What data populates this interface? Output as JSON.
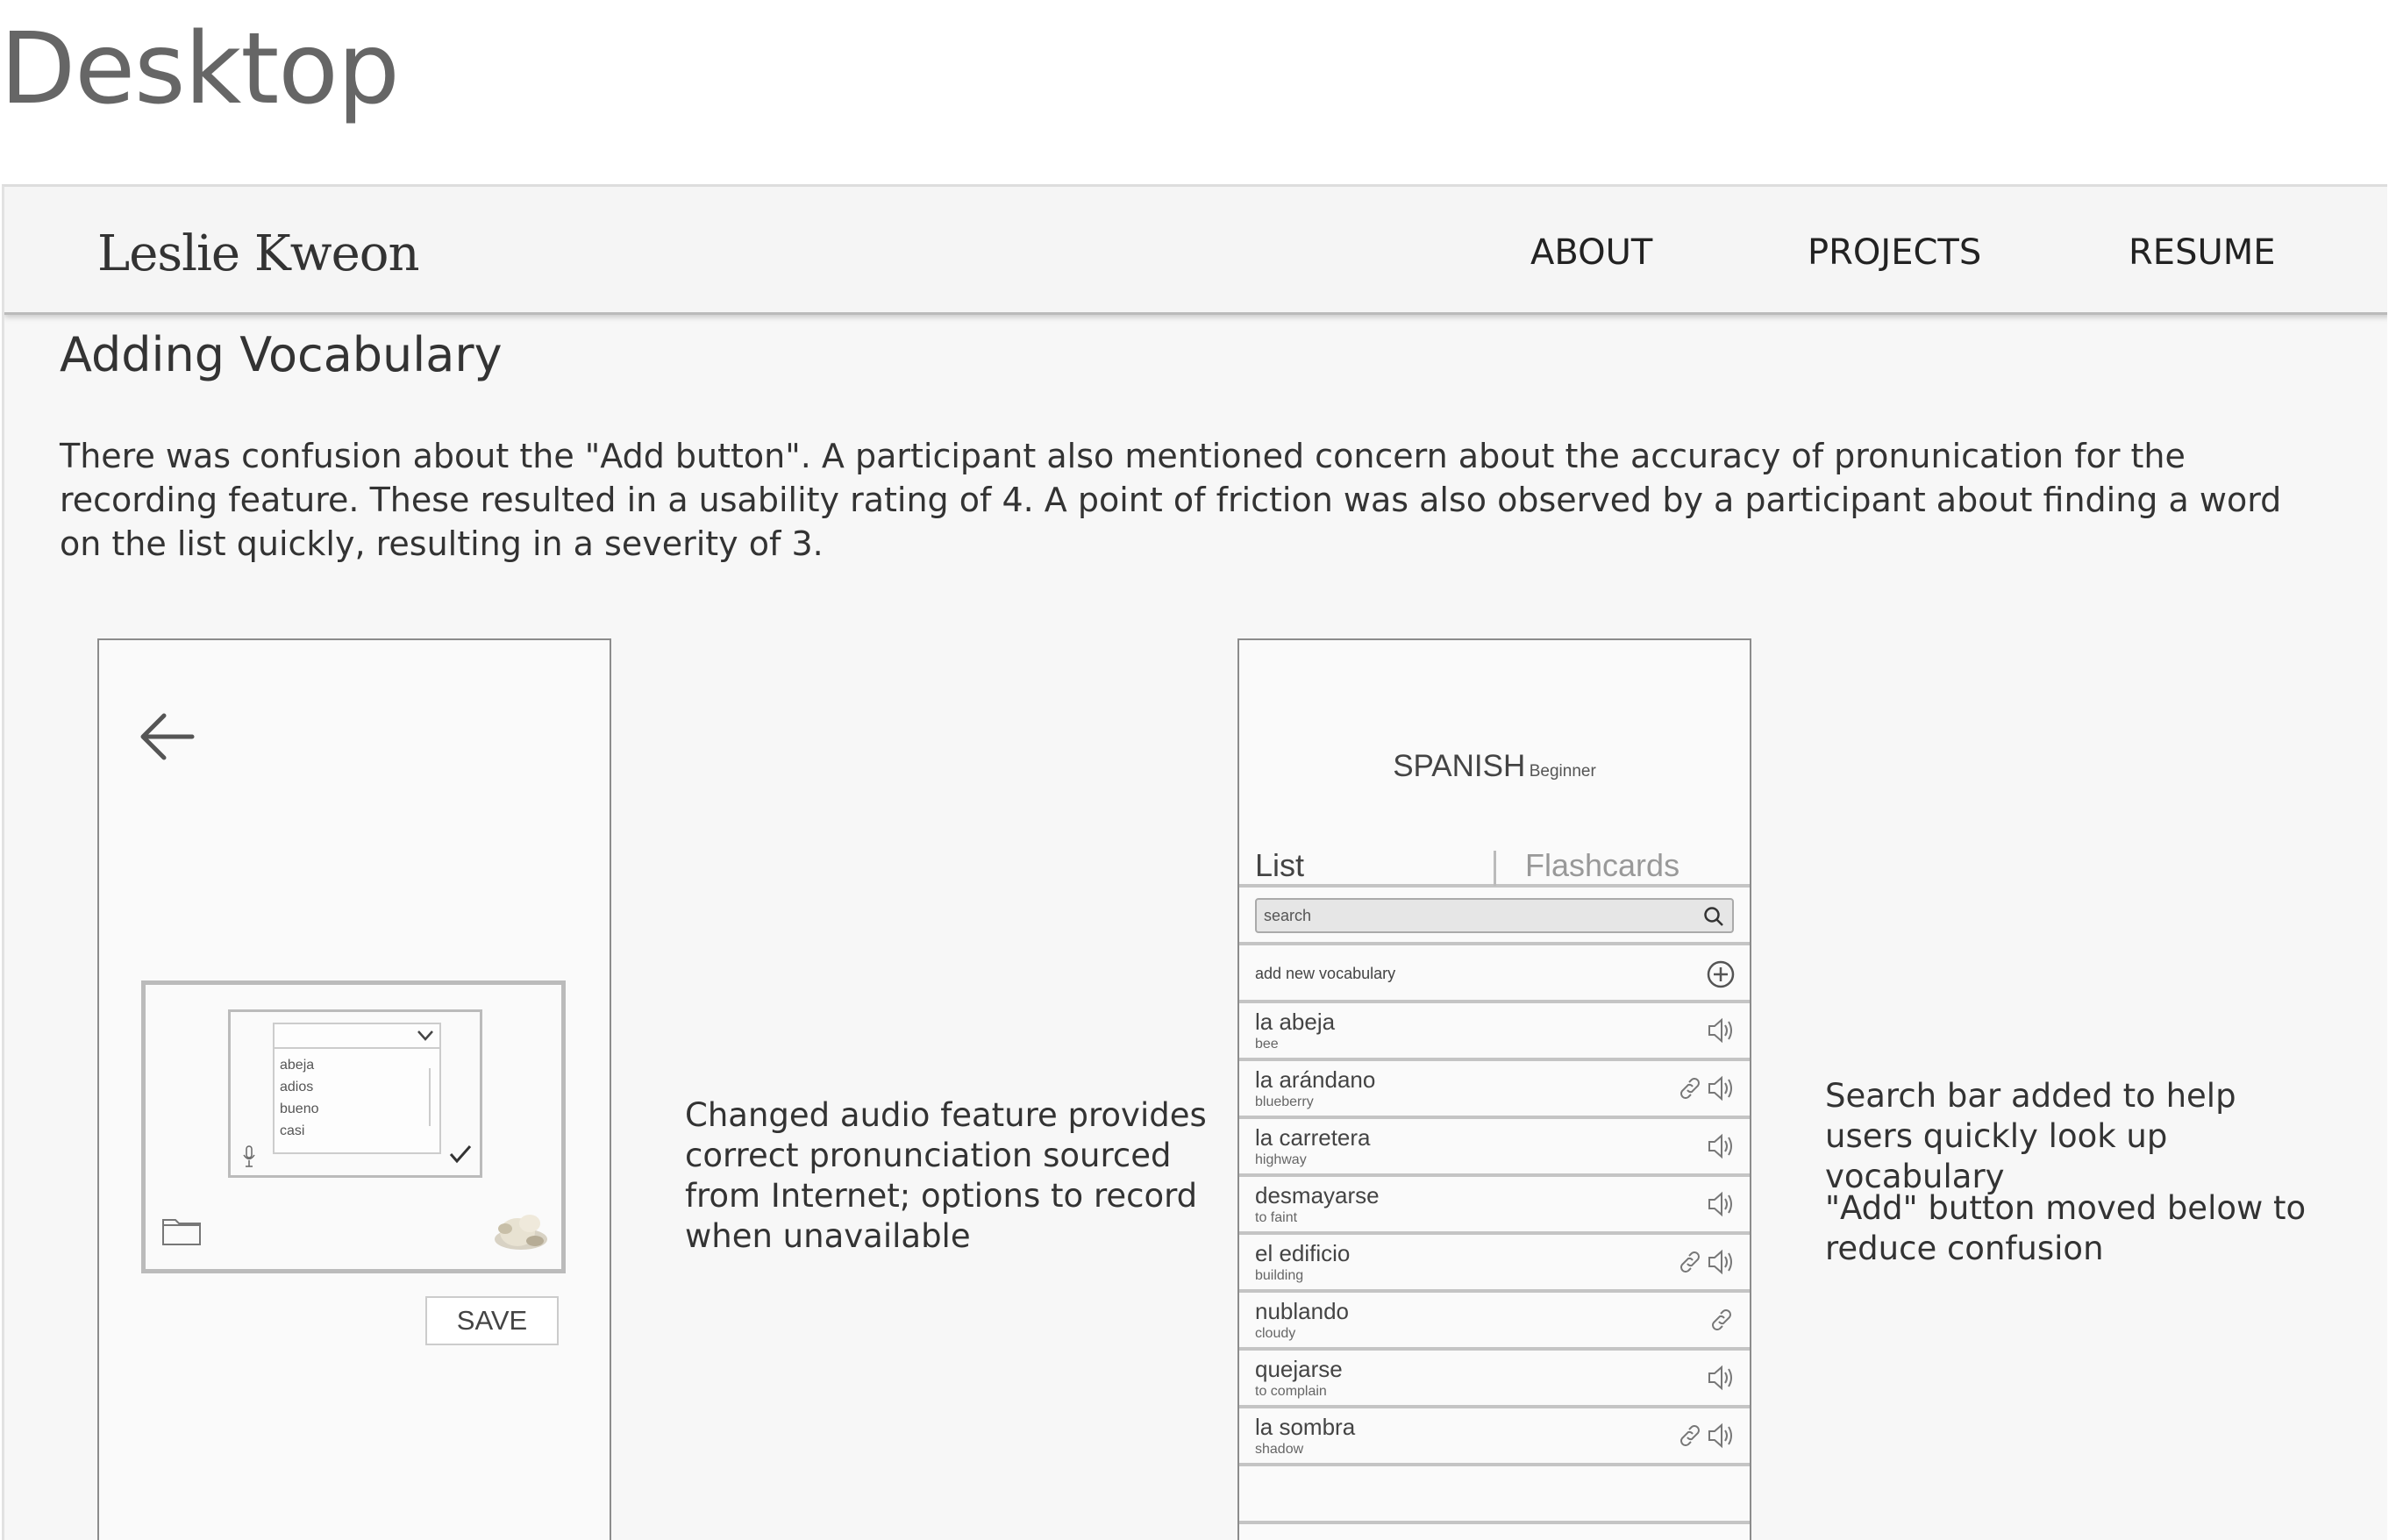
{
  "page": {
    "heading": "Desktop"
  },
  "navbar": {
    "logo": "Leslie Kweon",
    "links": [
      "ABOUT",
      "PROJECTS",
      "RESUME"
    ]
  },
  "section": {
    "title": "Adding Vocabulary",
    "paragraph": "There was confusion about the \"Add button\". A participant also mentioned concern about the accuracy of pronunication for the recording feature. These resulted in a usability rating of 4. A point of friction was also observed by a participant about finding a word on the list quickly, resulting in a severity of 3."
  },
  "left_mockup": {
    "dropdown_options": [
      "abeja",
      "adios",
      "bueno",
      "casi"
    ],
    "save_label": "SAVE"
  },
  "audio_note": "Changed audio feature provides correct pronunciation sourced from Internet; options to record when unavailable",
  "right_mockup": {
    "title": "SPANISH",
    "level": "Beginner",
    "tabs": [
      "List",
      "Flashcards"
    ],
    "search_placeholder": "search",
    "add_label": "add new vocabulary",
    "vocab": [
      {
        "word": "la abeja",
        "translation": "bee",
        "icons": [
          "speaker"
        ]
      },
      {
        "word": "la arándano",
        "translation": "blueberry",
        "icons": [
          "link",
          "speaker"
        ]
      },
      {
        "word": "la carretera",
        "translation": "highway",
        "icons": [
          "speaker"
        ]
      },
      {
        "word": "desmayarse",
        "translation": "to faint",
        "icons": [
          "speaker"
        ]
      },
      {
        "word": "el edificio",
        "translation": "building",
        "icons": [
          "link",
          "speaker"
        ]
      },
      {
        "word": "nublando",
        "translation": "cloudy",
        "icons": [
          "link"
        ]
      },
      {
        "word": "quejarse",
        "translation": "to complain",
        "icons": [
          "speaker"
        ]
      },
      {
        "word": "la sombra",
        "translation": "shadow",
        "icons": [
          "link",
          "speaker"
        ]
      }
    ]
  },
  "search_note": "Search bar added to help users quickly look up vocabulary",
  "add_note": "\"Add\" button moved below to reduce confusion"
}
